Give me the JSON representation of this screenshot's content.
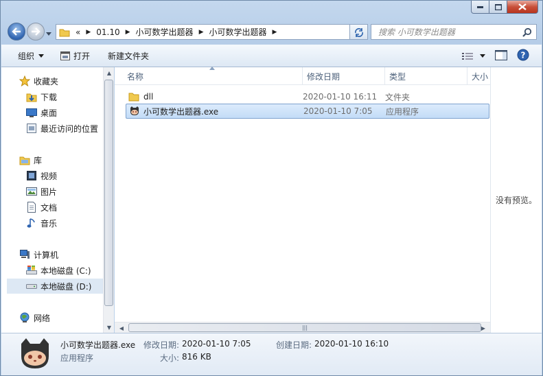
{
  "address": {
    "overflow": "«",
    "crumbs": [
      "01.10",
      "小可数学出题器",
      "小可数学出题器"
    ]
  },
  "search": {
    "placeholder": "搜索 小可数学出题器"
  },
  "toolbar": {
    "organize": "组织",
    "open": "打开",
    "new_folder": "新建文件夹"
  },
  "nav": {
    "favorites": "收藏夹",
    "downloads": "下载",
    "desktop": "桌面",
    "recent": "最近访问的位置",
    "libraries": "库",
    "videos": "视频",
    "pictures": "图片",
    "documents": "文档",
    "music": "音乐",
    "computer": "计算机",
    "drive_c": "本地磁盘 (C:)",
    "drive_d": "本地磁盘 (D:)",
    "network": "网络"
  },
  "columns": {
    "name": "名称",
    "modified": "修改日期",
    "type": "类型",
    "size": "大小"
  },
  "files": [
    {
      "name": "dll",
      "modified": "2020-01-10 16:11",
      "type": "文件夹"
    },
    {
      "name": "小可数学出题器.exe",
      "modified": "2020-01-10 7:05",
      "type": "应用程序"
    }
  ],
  "preview": {
    "text": "没有预览。"
  },
  "details": {
    "filename": "小可数学出题器.exe",
    "filetype": "应用程序",
    "modified_label": "修改日期:",
    "modified_value": "2020-01-10 7:05",
    "created_label": "创建日期:",
    "created_value": "2020-01-10 16:10",
    "size_label": "大小:",
    "size_value": "816 KB"
  },
  "colors": {
    "selection": "#cce4fb",
    "accent": "#2f64b0"
  }
}
